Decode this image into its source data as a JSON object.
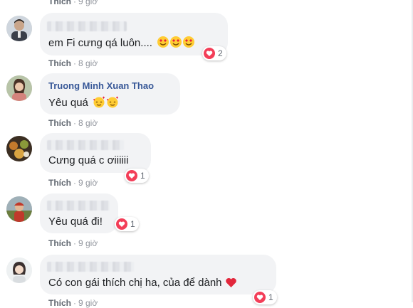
{
  "comments": [
    {
      "author": "",
      "text": "em Fi cưng qá luôn....",
      "meta": {
        "like_label": "Thích",
        "time": "8 giờ"
      },
      "reaction_count": "2",
      "emoji_desc": "heart-eyes x3"
    },
    {
      "author": "Truong Minh Xuan Thao",
      "text": "Yêu quá",
      "meta": {
        "like_label": "Thích",
        "time": "8 giờ"
      },
      "emoji_desc": "face-with-hearts x2"
    },
    {
      "author": "",
      "text": "Cưng quá c ơiiiiii",
      "meta": {
        "like_label": "Thích",
        "time": "9 giờ"
      },
      "reaction_count": "1"
    },
    {
      "author": "",
      "text": "Yêu quá đi!",
      "meta": {
        "like_label": "Thích",
        "time": "9 giờ"
      },
      "reaction_count": "1"
    },
    {
      "author": "",
      "text": "Có con gái thích chị ha, của để dành",
      "meta": {
        "like_label": "Thích",
        "time": "9 giờ"
      },
      "reaction_count": "1",
      "emoji_desc": "red-heart"
    }
  ],
  "top_meta": {
    "like_label": "Thích",
    "time": "9 giờ"
  },
  "colors": {
    "like_red": "#f33e58",
    "author_blue": "#385898",
    "bubble": "#f2f3f5"
  }
}
